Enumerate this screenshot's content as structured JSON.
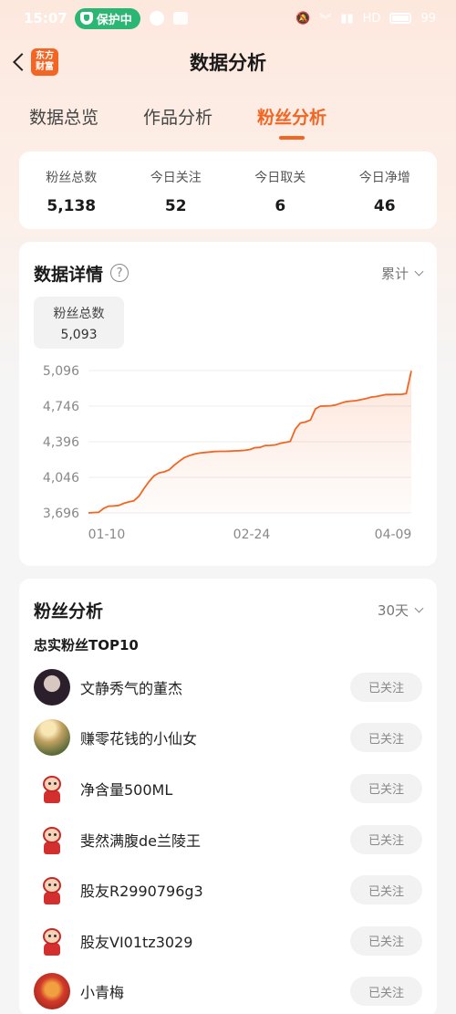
{
  "status_bar": {
    "time": "15:07",
    "shield_label": "保护中",
    "network": "HD",
    "battery": "99"
  },
  "header": {
    "title": "数据分析",
    "logo_text_line1": "东方",
    "logo_text_line2": "财富"
  },
  "tabs": [
    {
      "label": "数据总览",
      "active": false
    },
    {
      "label": "作品分析",
      "active": false
    },
    {
      "label": "粉丝分析",
      "active": true
    }
  ],
  "summary": [
    {
      "label": "粉丝总数",
      "value": "5,138"
    },
    {
      "label": "今日关注",
      "value": "52"
    },
    {
      "label": "今日取关",
      "value": "6"
    },
    {
      "label": "今日净增",
      "value": "46"
    }
  ],
  "detail": {
    "title": "数据详情",
    "help": "?",
    "dropdown": "累计",
    "tooltip_label": "粉丝总数",
    "tooltip_value": "5,093"
  },
  "chart_data": {
    "type": "area",
    "x_ticks": [
      "01-10",
      "02-24",
      "04-09"
    ],
    "y_ticks": [
      "5,096",
      "4,746",
      "4,396",
      "4,046",
      "3,696"
    ],
    "ylim": [
      3696,
      5096
    ],
    "color": "#f26522",
    "grid": "horizontal",
    "values": [
      3696,
      3700,
      3702,
      3740,
      3762,
      3765,
      3770,
      3790,
      3805,
      3815,
      3860,
      3935,
      4005,
      4060,
      4090,
      4100,
      4120,
      4165,
      4205,
      4240,
      4260,
      4275,
      4285,
      4290,
      4295,
      4300,
      4302,
      4302,
      4304,
      4306,
      4308,
      4312,
      4320,
      4338,
      4340,
      4358,
      4360,
      4365,
      4380,
      4390,
      4400,
      4520,
      4580,
      4590,
      4610,
      4720,
      4746,
      4748,
      4750,
      4758,
      4775,
      4790,
      4795,
      4800,
      4810,
      4820,
      4835,
      4840,
      4850,
      4860,
      4860,
      4862,
      4862,
      4870,
      5093
    ]
  },
  "fans": {
    "title": "粉丝分析",
    "dropdown": "30天",
    "subtitle": "忠实粉丝TOP10",
    "items": [
      {
        "name": "文静秀气的董杰",
        "avatar": "photo1",
        "button": "已关注"
      },
      {
        "name": "赚零花钱的小仙女",
        "avatar": "photo2",
        "button": "已关注"
      },
      {
        "name": "净含量500ML",
        "avatar": "mascot",
        "button": "已关注"
      },
      {
        "name": "斐然满腹de兰陵王",
        "avatar": "mascot",
        "button": "已关注"
      },
      {
        "name": "股友R2990796g3",
        "avatar": "mascot",
        "button": "已关注"
      },
      {
        "name": "股友VI01tz3029",
        "avatar": "mascot",
        "button": "已关注"
      },
      {
        "name": "小青梅",
        "avatar": "dragon",
        "button": "已关注"
      }
    ]
  }
}
